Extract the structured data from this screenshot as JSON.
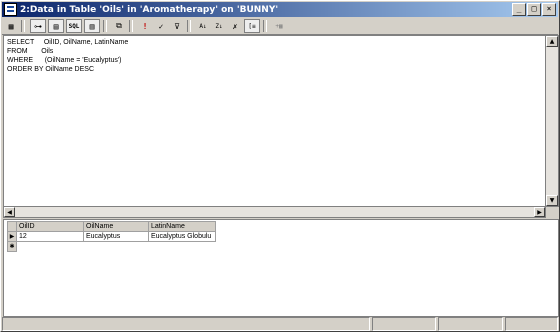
{
  "window": {
    "title": "2:Data in Table 'Oils' in 'Aromatherapy' on 'BUNNY'",
    "buttons": {
      "minimize": "_",
      "maximize": "□",
      "close": "×"
    }
  },
  "toolbar": {
    "items": [
      {
        "icon": "properties-icon",
        "glyph": "▦"
      },
      {
        "icon": "diagram-pane-icon",
        "glyph": "⊶"
      },
      {
        "icon": "grid-pane-icon",
        "glyph": "▤"
      },
      {
        "icon": "sql-pane-icon",
        "glyph": "SQL"
      },
      {
        "icon": "results-pane-icon",
        "glyph": "▥"
      },
      {
        "icon": "query-type-icon",
        "glyph": "⧉"
      },
      {
        "icon": "run-icon",
        "glyph": "!"
      },
      {
        "icon": "verify-sql-icon",
        "glyph": "✓"
      },
      {
        "icon": "remove-filter-icon",
        "glyph": "⊽"
      },
      {
        "icon": "sort-ascending-icon",
        "glyph": "A↓"
      },
      {
        "icon": "sort-descending-icon",
        "glyph": "Z↓"
      },
      {
        "icon": "remove-filter-icon-2",
        "glyph": "✗"
      },
      {
        "icon": "group-by-icon",
        "glyph": "[≡"
      },
      {
        "icon": "add-table-icon",
        "glyph": "+▦"
      }
    ]
  },
  "sql": {
    "lines": [
      "SELECT     OilID, OilName, LatinName",
      "FROM       Oils",
      "WHERE      (OilName = 'Eucalyptus')",
      "ORDER BY OilName DESC"
    ]
  },
  "grid": {
    "columns": [
      "OilID",
      "OilName",
      "LatinName"
    ],
    "rows": [
      {
        "marker": "▶",
        "cells": [
          "12",
          "Eucalyptus",
          "Eucalyptus Globulu"
        ]
      }
    ],
    "new_row_marker": "✱"
  },
  "colors": {
    "titlebar_start": "#0a246a",
    "titlebar_end": "#a6caf0",
    "face": "#d4d0c8"
  }
}
